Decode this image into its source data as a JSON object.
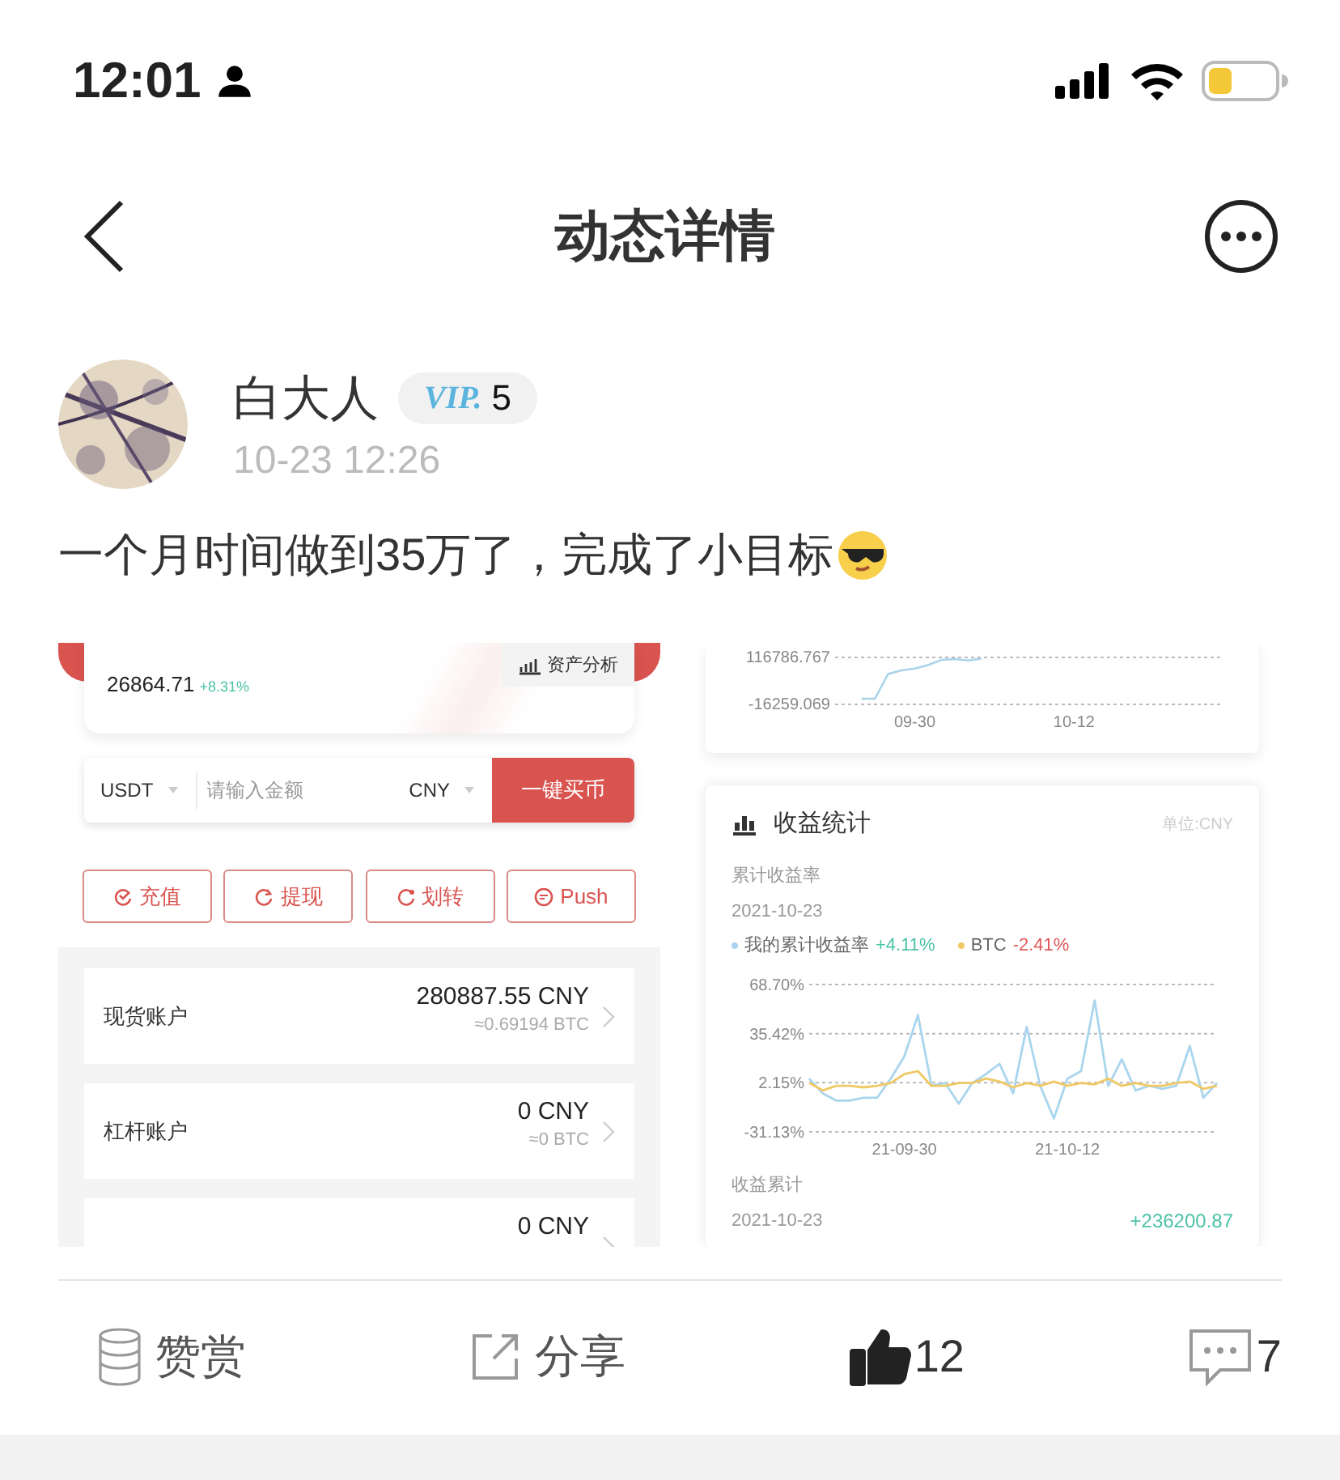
{
  "status_bar": {
    "time": "12:01"
  },
  "nav": {
    "title": "动态详情"
  },
  "post": {
    "author": "白大人",
    "vip_logo": "VIP.",
    "vip_level": "5",
    "time": "10-23 12:26",
    "text": "一个月时间做到35万了，完成了小目标"
  },
  "screenshot": {
    "profit_card": {
      "value": "26864.71",
      "change": "+8.31%",
      "analysis_button": "资产分析"
    },
    "buy_bar": {
      "coin": "USDT",
      "placeholder": "请输入金额",
      "currency": "CNY",
      "button": "一键买币"
    },
    "actions": [
      {
        "kind": "deposit",
        "label": "充值"
      },
      {
        "kind": "withdraw",
        "label": "提现"
      },
      {
        "kind": "transfer",
        "label": "划转"
      },
      {
        "kind": "push",
        "label": "Push"
      }
    ],
    "accounts": [
      {
        "name": "现货账户",
        "amount": "280887.55 CNY",
        "btc": "≈0.69194 BTC"
      },
      {
        "name": "杠杆账户",
        "amount": "0 CNY",
        "btc": "≈0 BTC"
      },
      {
        "amount": "0 CNY"
      }
    ],
    "asset_chart": {
      "chart_data": {
        "type": "line",
        "categories": [
          null,
          null,
          null,
          null,
          null,
          null,
          "09-30",
          null,
          null,
          null,
          null,
          null,
          null,
          null,
          null,
          null,
          null,
          null,
          "10-12",
          null,
          null,
          null,
          null,
          null,
          null,
          null,
          null,
          null,
          null,
          null
        ],
        "ylim": [
          -16259.069,
          116786.767
        ],
        "yticks": [
          {
            "value": 116786.767,
            "label": "116786.767"
          },
          {
            "value": -16259.069,
            "label": "-16259.069"
          }
        ],
        "series": [
          {
            "color": "#a9d3e8",
            "values": [
              null,
              null,
              0,
              0,
              70000,
              80000,
              85000,
              95000,
              110000,
              112000,
              108000,
              113000,
              null,
              null,
              null,
              null,
              null,
              null,
              null,
              null,
              null,
              null,
              null,
              null,
              null,
              null,
              null,
              null,
              null,
              null
            ]
          }
        ]
      }
    },
    "stats": {
      "title": "收益统计",
      "unit": "单位:CNY",
      "rate_label": "累计收益率",
      "rate_date": "2021-10-23",
      "legend_values": [
        {
          "value": "+4.11%",
          "color": "#4cc2a6"
        },
        {
          "value": "-2.41%",
          "color": "#e0585a"
        }
      ],
      "chart_data": {
        "type": "line",
        "categories": [
          null,
          null,
          null,
          null,
          null,
          null,
          null,
          "21-09-30",
          null,
          null,
          null,
          null,
          null,
          null,
          null,
          null,
          null,
          null,
          null,
          "21-10-12",
          null,
          null,
          null,
          null,
          null,
          null,
          null,
          null,
          null,
          null,
          null
        ],
        "ylim": [
          -31.13,
          68.7
        ],
        "yticks": [
          {
            "value": 68.7,
            "label": "68.70%"
          },
          {
            "value": 35.42,
            "label": "35.42%"
          },
          {
            "value": 2.15,
            "label": "2.15%"
          },
          {
            "value": -31.13,
            "label": "-31.13%"
          }
        ],
        "series": [
          {
            "name": "我的累计收益率",
            "color": "#a9d5ee",
            "values": [
              5,
              -5,
              -10,
              -10,
              -8,
              -8,
              5,
              20,
              48,
              0,
              2,
              -12,
              2,
              8,
              15,
              -5,
              40,
              0,
              -22,
              5,
              10,
              58,
              0,
              18,
              -3,
              0,
              -2,
              0,
              27,
              -8,
              2
            ]
          },
          {
            "name": "BTC",
            "color": "#f0c865",
            "values": [
              2,
              -3,
              0,
              0,
              -1,
              0,
              2,
              8,
              10,
              0,
              0,
              2,
              2,
              5,
              3,
              -1,
              2,
              0,
              3,
              0,
              2,
              1,
              5,
              0,
              2,
              0,
              0,
              2,
              3,
              -2,
              0
            ]
          }
        ]
      },
      "total_label": "收益累计",
      "total_date": "2021-10-23",
      "total_value": "+236200.87"
    }
  },
  "footer": {
    "reward": "赞赏",
    "share": "分享",
    "likes": "12",
    "liked": true,
    "comments": "7"
  }
}
